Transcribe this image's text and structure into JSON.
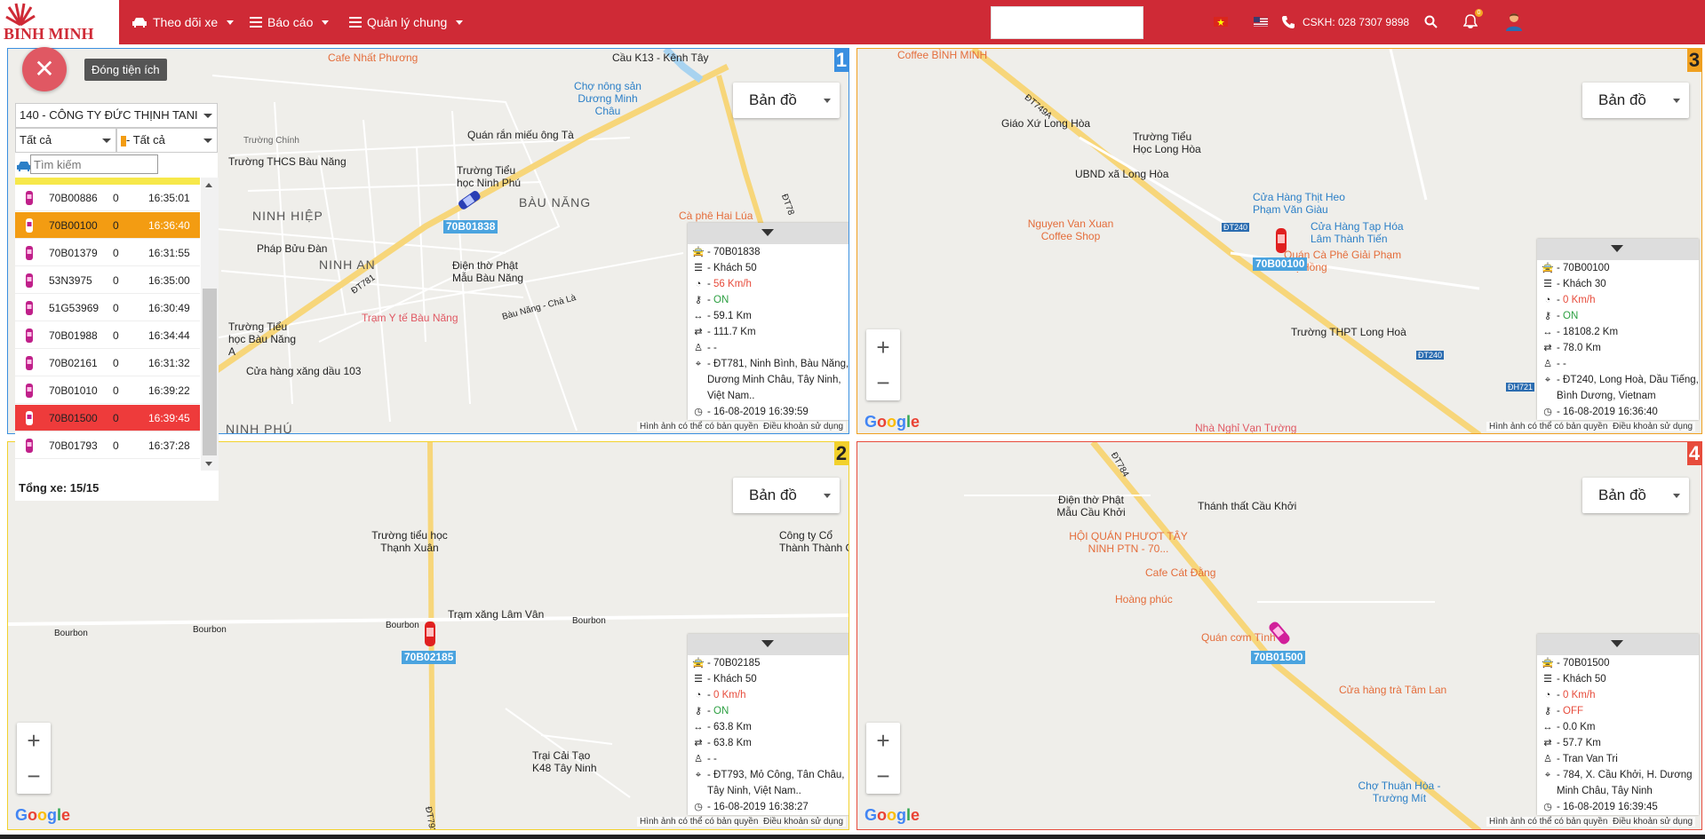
{
  "header": {
    "logo_text": "BINH MINH",
    "nav": [
      {
        "label": "Theo dõi xe",
        "icon": "car-icon"
      },
      {
        "label": "Báo cáo",
        "icon": "list-icon"
      },
      {
        "label": "Quản lý chung",
        "icon": "list-icon"
      }
    ],
    "hotline": "CSKH: 028 7307 9898",
    "notification_count": "0",
    "colors": {
      "brand": "#cf2a36"
    }
  },
  "widget": {
    "close_tooltip": "Đóng tiện ích",
    "company_select": "140 - CÔNG TY ĐỨC THỊNH TANI",
    "filter_1": "Tất cả",
    "filter_2": "- Tất cả",
    "search_placeholder": "Tìm kiếm",
    "vehicles": [
      {
        "plate": "70B00886",
        "speed": "0",
        "time": "16:35:01",
        "color": "#ffffff"
      },
      {
        "plate": "70B00100",
        "speed": "0",
        "time": "16:36:40",
        "color": "#f39c12"
      },
      {
        "plate": "70B01379",
        "speed": "0",
        "time": "16:31:55",
        "color": "#ffffff"
      },
      {
        "plate": "53N3975",
        "speed": "0",
        "time": "16:35:00",
        "color": "#ffffff"
      },
      {
        "plate": "51G53969",
        "speed": "0",
        "time": "16:30:49",
        "color": "#ffffff"
      },
      {
        "plate": "70B01988",
        "speed": "0",
        "time": "16:34:44",
        "color": "#ffffff"
      },
      {
        "plate": "70B02161",
        "speed": "0",
        "time": "16:31:32",
        "color": "#ffffff"
      },
      {
        "plate": "70B01010",
        "speed": "0",
        "time": "16:39:22",
        "color": "#ffffff"
      },
      {
        "plate": "70B01500",
        "speed": "0",
        "time": "16:39:45",
        "color": "#ee3b3b"
      },
      {
        "plate": "70B01793",
        "speed": "0",
        "time": "16:37:28",
        "color": "#ffffff"
      }
    ],
    "total": "Tổng xe: 15/15"
  },
  "map_common": {
    "map_type": "Bản đồ",
    "google": "Google",
    "terms_1": "Hình ảnh có thể có bản quyền",
    "terms_2": "Điều khoản sử dụng"
  },
  "panels": [
    {
      "number": "1",
      "border": "#3a8fe0",
      "vehicle_label": "70B01838",
      "info": {
        "plate": "70B01838",
        "passengers": "Khách 50",
        "speed": "56 Km/h",
        "engine": "ON",
        "distance1": "59.1 Km",
        "distance2": "111.7 Km",
        "driver": "-",
        "address": "ĐT781, Ninh Bình, Bàu Năng, Dương Minh Châu, Tây Ninh, Việt Nam..",
        "time": "16-08-2019 16:39:59"
      },
      "map_labels": [
        "Cafe Nhất Phương",
        "Cầu K13 - Kênh Tây",
        "Chợ nông sản Dương Minh Châu",
        "Quán rắn miếu ông Tà",
        "Trường THCS Bàu Năng",
        "Trường Tiểu học Ninh Phú",
        "BÀU NĂNG",
        "NINH HIỆP",
        "NINH AN",
        "Pháp Bửu Đàn",
        "Điện thờ Phật Mẫu Bàu Năng",
        "Cà phê Hai Lúa",
        "Trạm Y tế Bàu Năng",
        "Trường Tiểu học Bàu Năng A",
        "Cửa hàng xăng dầu 103",
        "Bàu Năng - Chà Là",
        "ĐT781",
        "ĐT78",
        "Trường Chính",
        "NINH PHÚ"
      ]
    },
    {
      "number": "3",
      "border": "#f0a020",
      "vehicle_label": "70B00100",
      "info": {
        "plate": "70B00100",
        "passengers": "Khách 30",
        "speed": "0 Km/h",
        "engine": "ON",
        "distance1": "18108.2 Km",
        "distance2": "78.0 Km",
        "driver": "-",
        "address": "ĐT240, Long Hoà, Dầu Tiếng, Bình Dương, Vietnam",
        "time": "16-08-2019 16:36:40"
      },
      "map_labels": [
        "Coffee BÌNH MINH",
        "ĐT749A",
        "Giáo Xứ Long Hòa",
        "Trường Tiểu Học Long Hòa",
        "UBND xã Long Hòa",
        "Cửa Hàng Thịt Heo Phạm Văn Giàu",
        "Cửa Hàng Tạp Hóa Lâm Thành Tiến",
        "Nguyen Van Xuan Coffee Shop",
        "Quán Cà Phê Giải Phạm Thị Hồng",
        "Trường THPT Long Hoà",
        "Nhà Nghỉ Vạn Tường",
        "ĐT240",
        "ĐH721"
      ]
    },
    {
      "number": "2",
      "border": "#f2d12c",
      "vehicle_label": "70B02185",
      "info": {
        "plate": "70B02185",
        "passengers": "Khách 50",
        "speed": "0 Km/h",
        "engine": "ON",
        "distance1": "63.8 Km",
        "distance2": "63.8 Km",
        "driver": "-",
        "address": "ĐT793, Mỏ Công, Tân Châu, Tây Ninh, Việt Nam..",
        "time": "16-08-2019 16:38:27"
      },
      "map_labels": [
        "Trường tiểu học Thạnh Xuân",
        "Công ty Cổ Thành Thành C",
        "Trạm xăng Lâm Vân",
        "Bourbon",
        "Bourbon",
        "Bourbon",
        "Bourbon",
        "Trại Cải Tạo K48 Tây Ninh",
        "ĐT793"
      ]
    },
    {
      "number": "4",
      "border": "#e74c3c",
      "vehicle_label": "70B01500",
      "info": {
        "plate": "70B01500",
        "passengers": "Khách 50",
        "speed": "0 Km/h",
        "engine": "OFF",
        "distance1": "0.0 Km",
        "distance2": "57.7 Km",
        "driver": "Tran Van Tri",
        "address": "784, X. Cầu Khởi, H. Dương Minh Châu, Tây Ninh",
        "time": "16-08-2019 16:39:45"
      },
      "map_labels": [
        "ĐT784",
        "Điện thờ Phật Mẫu Cầu Khởi",
        "Thánh thất Cầu Khởi",
        "HỘI QUÁN PHƯỢT TÂY NINH PTN - 70...",
        "Cafe Cát Đằng",
        "Hoàng phúc",
        "Quán cơm Tình",
        "Cửa hàng trà Tâm Lan",
        "Chợ Thuận Hòa - Trường Mít"
      ]
    }
  ]
}
